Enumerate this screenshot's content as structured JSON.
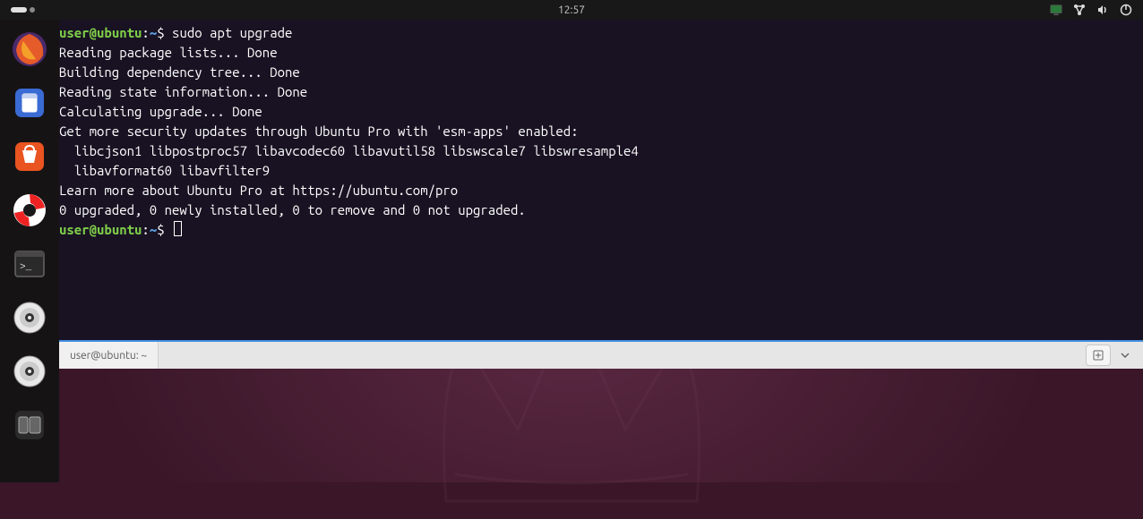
{
  "topbar": {
    "time": "12:57"
  },
  "dock": {
    "items": [
      {
        "name": "firefox",
        "label": "Firefox"
      },
      {
        "name": "files",
        "label": "Files"
      },
      {
        "name": "software",
        "label": "Ubuntu Software"
      },
      {
        "name": "help",
        "label": "Help"
      },
      {
        "name": "terminal",
        "label": "Terminal"
      },
      {
        "name": "disk1",
        "label": "Drive"
      },
      {
        "name": "disk2",
        "label": "Drive"
      },
      {
        "name": "folder",
        "label": "Folder"
      }
    ]
  },
  "terminal": {
    "tab_label": "user@ubuntu: ~",
    "prompt": {
      "user": "user",
      "at": "@",
      "host": "ubuntu",
      "colon": ":",
      "path": "~",
      "dollar": "$ "
    },
    "command1": "sudo apt upgrade",
    "lines": [
      "Reading package lists... Done",
      "Building dependency tree... Done",
      "Reading state information... Done",
      "Calculating upgrade... Done",
      "Get more security updates through Ubuntu Pro with 'esm-apps' enabled:",
      "  libcjson1 libpostproc57 libavcodec60 libavutil58 libswscale7 libswresample4",
      "  libavformat60 libavfilter9",
      "Learn more about Ubuntu Pro at https://ubuntu.com/pro",
      "0 upgraded, 0 newly installed, 0 to remove and 0 not upgraded."
    ]
  }
}
